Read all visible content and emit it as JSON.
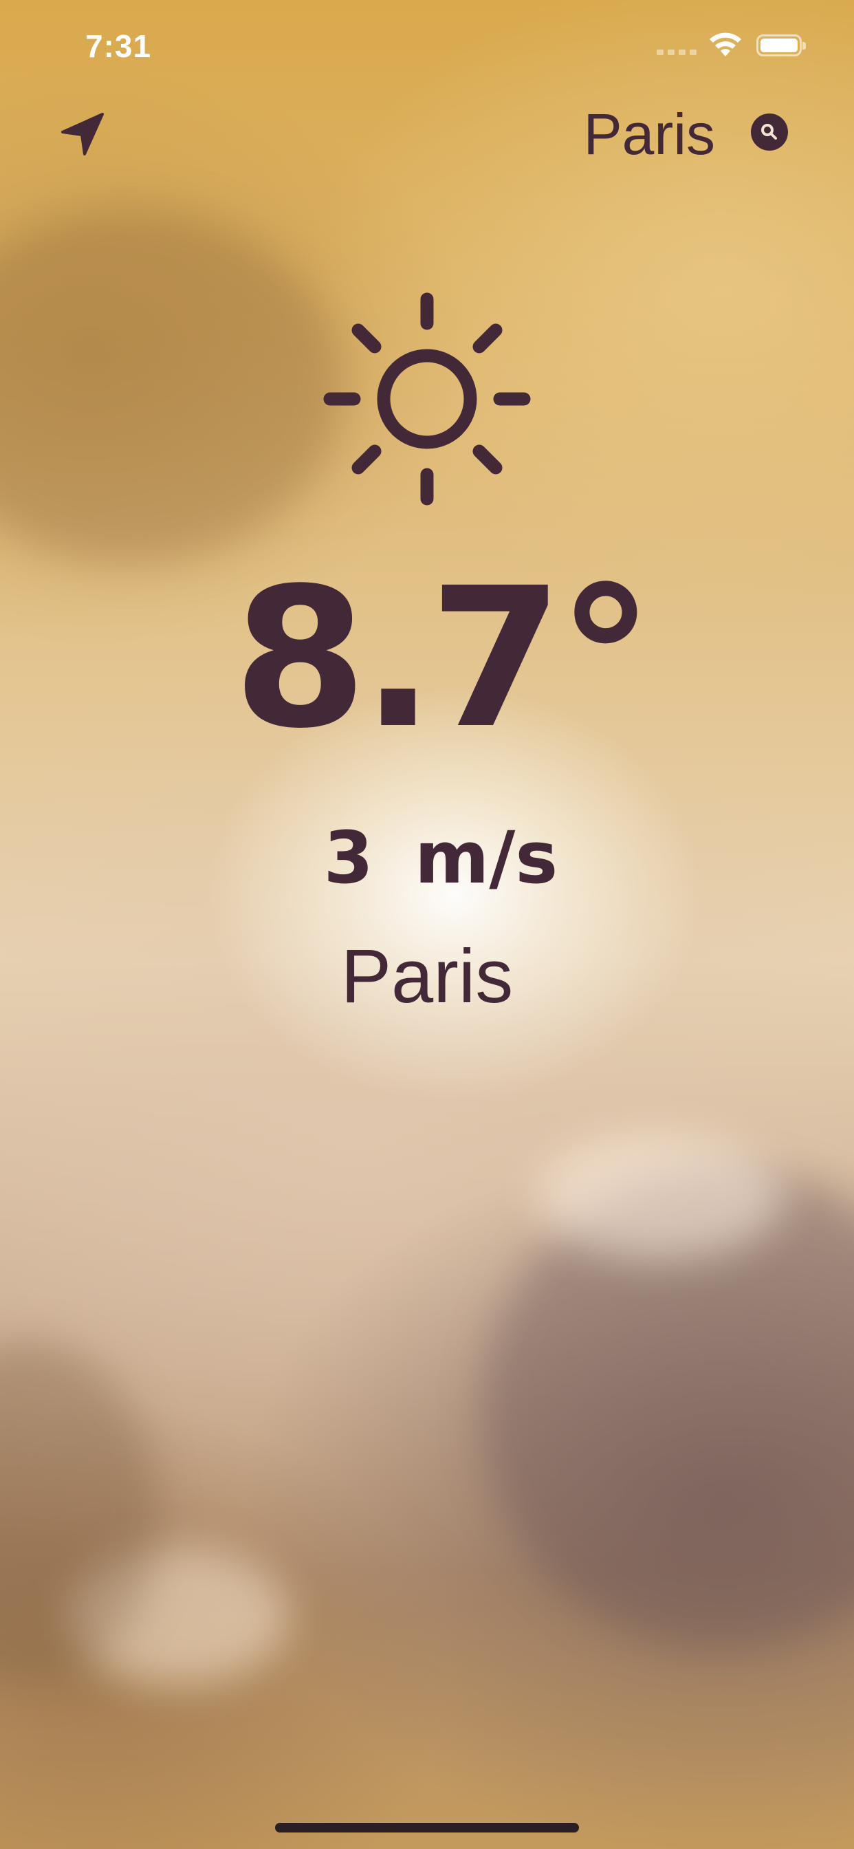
{
  "status_bar": {
    "time": "7:31"
  },
  "nav": {
    "location_icon": "location-arrow-icon",
    "city_field_value": "Paris",
    "search_icon": "magnifier-icon"
  },
  "weather": {
    "condition_icon": "sun-icon",
    "temperature": "8.7°",
    "wind_value": "3",
    "wind_unit": "m/s",
    "city": "Paris"
  },
  "colors": {
    "ink": "#432838",
    "status_bar_text": "#ffffff"
  }
}
